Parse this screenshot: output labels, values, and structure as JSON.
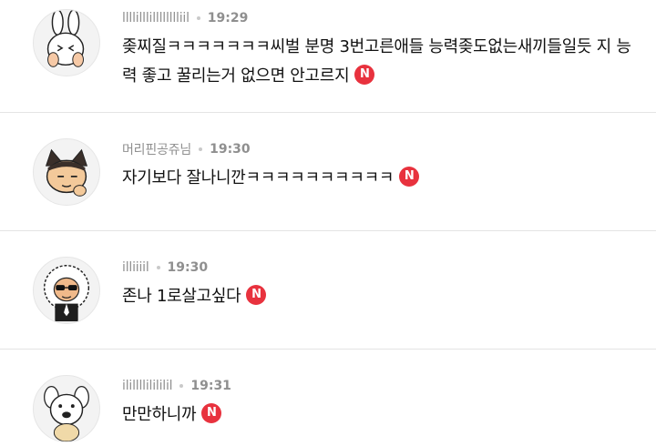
{
  "comments": [
    {
      "nickname": "llllilllilllllllliil",
      "time": "19:29",
      "text": "좆찌질ㅋㅋㅋㅋㅋㅋㅋ씨벌 분명 3번고른애들 능력좆도없는새끼들일듯 지 능력 좋고 꿀리는거 없으면 안고르지",
      "badge": "N",
      "avatar_icon": "rabbit-character-icon"
    },
    {
      "nickname": "머리핀공쥬님",
      "time": "19:30",
      "text": "자기보다 잘나니깐ㅋㅋㅋㅋㅋㅋㅋㅋㅋㅋ",
      "badge": "N",
      "avatar_icon": "cat-character-icon"
    },
    {
      "nickname": "illiiiil",
      "time": "19:30",
      "text": "존나 1로살고싶다",
      "badge": "N",
      "avatar_icon": "lion-sunglasses-character-icon"
    },
    {
      "nickname": "ilillllilililil",
      "time": "19:31",
      "text": "만만하니까",
      "badge": "N",
      "avatar_icon": "dog-character-icon"
    }
  ],
  "colors": {
    "badge": "#e8323e",
    "meta": "#8f8f8f",
    "divider": "#e4e4e4"
  }
}
